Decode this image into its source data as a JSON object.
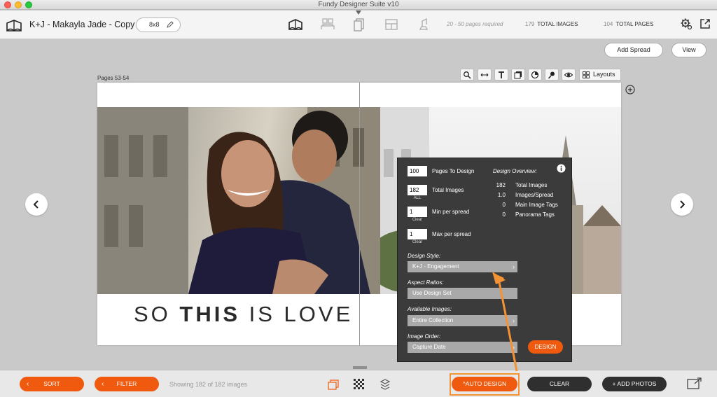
{
  "window": {
    "title": "Fundy Designer Suite v10"
  },
  "toolbar": {
    "project_name": "K+J - Makayla Jade - Copy",
    "album_size": "8x8",
    "pages_required": "20 - 50 pages required",
    "total_images_count": "179",
    "total_images_label": "TOTAL IMAGES",
    "total_pages_count": "104",
    "total_pages_label": "TOTAL PAGES"
  },
  "actions": {
    "add_spread": "Add Spread",
    "view": "View"
  },
  "page": {
    "label": "Pages 53-54",
    "layouts_label": "Layouts"
  },
  "spread": {
    "caption_pre": "SO ",
    "caption_bold": "THIS",
    "caption_post": " IS LOVE"
  },
  "auto_design": {
    "pages_to_design_value": "100",
    "pages_to_design_label": "Pages To Design",
    "total_images_value": "182",
    "total_images_sub": "ALL",
    "total_images_label": "Total Images",
    "min_value": "1",
    "min_sub": "Clear",
    "min_label": "Min per spread",
    "max_value": "1",
    "max_sub": "Clear",
    "max_label": "Max per spread",
    "overview_title": "Design Overview:",
    "overview": [
      {
        "num": "182",
        "label": "Total Images"
      },
      {
        "num": "1.0",
        "label": "Images/Spread"
      },
      {
        "num": "0",
        "label": "Main Image Tags"
      },
      {
        "num": "0",
        "label": "Panorama Tags"
      }
    ],
    "design_style_label": "Design Style:",
    "design_style_value": "K+J - Engagement",
    "aspect_ratios_label": "Aspect Ratios:",
    "aspect_ratios_value": "Use Design Set",
    "available_images_label": "Available Images:",
    "available_images_value": "Entire Collection",
    "image_order_label": "Image Order:",
    "image_order_value": "Capture Date",
    "design_button": "DESIGN"
  },
  "bottom": {
    "sort": "SORT",
    "filter": "FILTER",
    "showing": "Showing 182 of 182 images",
    "auto_design": "AUTO DESIGN",
    "clear": "CLEAR",
    "add_photos": "+ ADD PHOTOS"
  },
  "colors": {
    "accent": "#ef5a0e",
    "highlight": "#f39333",
    "panel": "#3b3b3b"
  }
}
